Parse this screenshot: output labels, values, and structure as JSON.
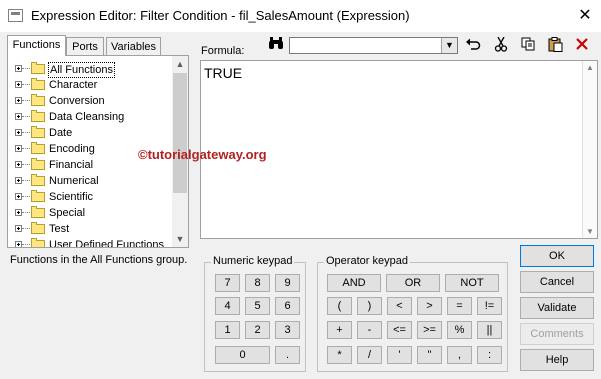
{
  "window": {
    "title": "Expression Editor: Filter Condition - fil_SalesAmount (Expression)",
    "close_glyph": "✕"
  },
  "tabs": [
    {
      "label": "Functions"
    },
    {
      "label": "Ports"
    },
    {
      "label": "Variables"
    }
  ],
  "tree": {
    "items": [
      {
        "label": "All Functions",
        "selected": true
      },
      {
        "label": "Character"
      },
      {
        "label": "Conversion"
      },
      {
        "label": "Data Cleansing"
      },
      {
        "label": "Date"
      },
      {
        "label": "Encoding"
      },
      {
        "label": "Financial"
      },
      {
        "label": "Numerical"
      },
      {
        "label": "Scientific"
      },
      {
        "label": "Special"
      },
      {
        "label": "Test"
      },
      {
        "label": "User Defined Functions"
      }
    ]
  },
  "status": "Functions in the All Functions group.",
  "formula": {
    "label": "Formula:",
    "value": "TRUE"
  },
  "toolbar": {
    "search_combo_value": "",
    "icons": [
      "binoculars-icon",
      "undo-icon",
      "cut-icon",
      "copy-icon",
      "paste-icon",
      "delete-icon"
    ]
  },
  "watermark": "©tutorialgateway.org",
  "numeric_keypad": {
    "label": "Numeric keypad",
    "keys": [
      "7",
      "8",
      "9",
      "4",
      "5",
      "6",
      "1",
      "2",
      "3",
      "0",
      "."
    ]
  },
  "operator_keypad": {
    "label": "Operator keypad",
    "keys": [
      "AND",
      "OR",
      "NOT",
      "(",
      ")",
      "<",
      ">",
      "=",
      "!=",
      "+",
      "-",
      "<=",
      ">=",
      "%",
      "||",
      "*",
      "/",
      "'",
      "\"",
      ",",
      ":"
    ]
  },
  "buttons": {
    "ok": "OK",
    "cancel": "Cancel",
    "validate": "Validate",
    "comments": "Comments",
    "help": "Help"
  },
  "colors": {
    "watermark": "#b22222",
    "delete_icon": "#cc0000",
    "default_button_border": "#0078d7"
  }
}
